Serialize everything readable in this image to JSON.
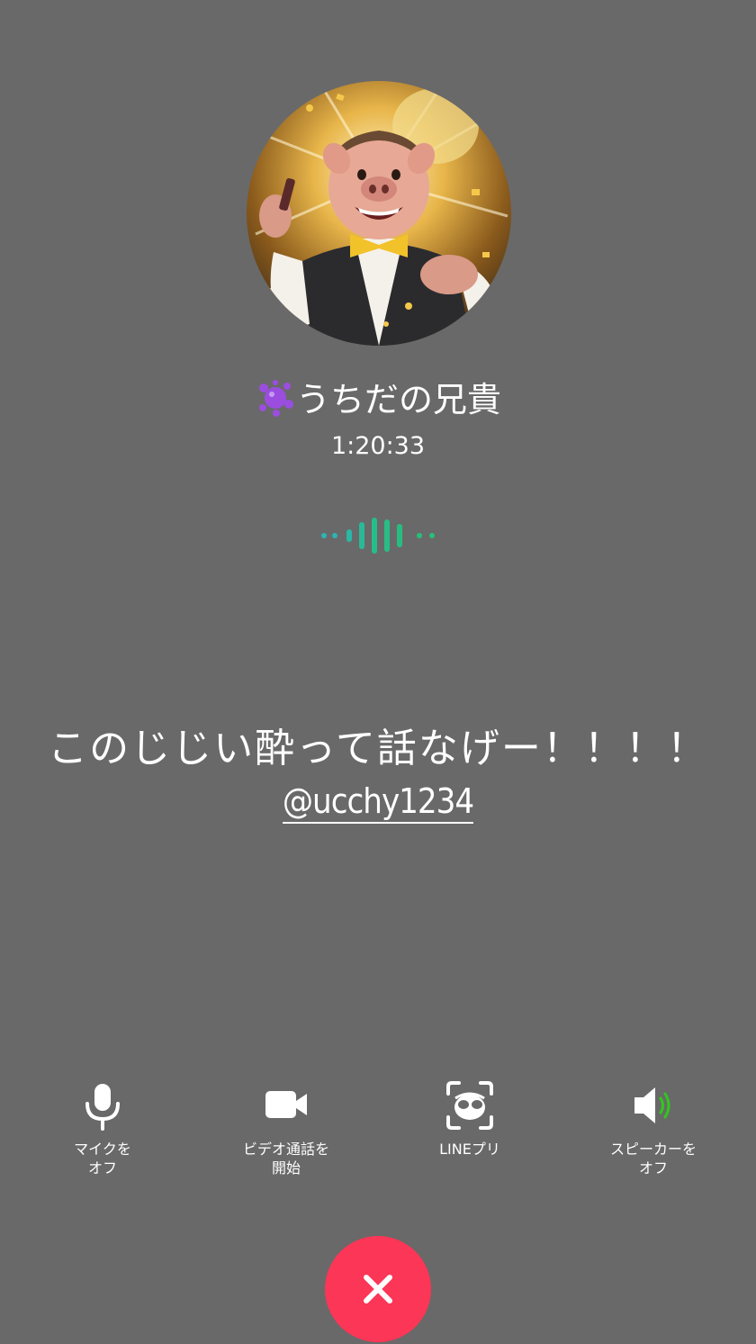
{
  "call": {
    "caller_name": "うちだの兄貴",
    "caller_emoji": "purple-splat-emoji",
    "duration": "1:20:33"
  },
  "overlay": {
    "caption": "このじじい酔って話なげー！！！！",
    "watermark": "@ucchy1234"
  },
  "controls": [
    {
      "id": "mic",
      "label": "マイクを\nオフ",
      "icon": "microphone-icon"
    },
    {
      "id": "video",
      "label": "ビデオ通話を\n開始",
      "icon": "video-camera-icon"
    },
    {
      "id": "filter",
      "label": "LINEプリ",
      "icon": "face-filter-icon"
    },
    {
      "id": "speaker",
      "label": "スピーカーを\nオフ",
      "icon": "speaker-icon"
    }
  ],
  "end_call": {
    "icon": "close-icon"
  },
  "colors": {
    "background": "#696969",
    "end_call": "#fb3656",
    "speaker_active": "#2ec81c",
    "waveform_teal": "#2bb5b4",
    "waveform_green": "#26c07a"
  }
}
